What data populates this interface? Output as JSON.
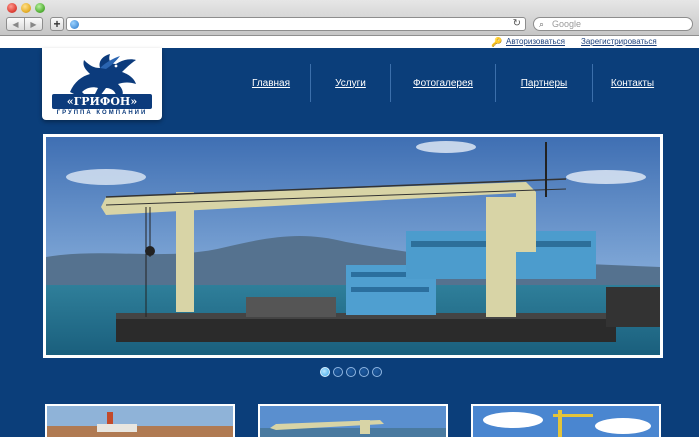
{
  "browser": {
    "search_placeholder": "Google",
    "back_icon": "◀",
    "forward_icon": "▶",
    "add_icon": "+",
    "reload_icon": "↻",
    "search_icon": "⌕"
  },
  "topbar": {
    "login_label": "Авторизоваться",
    "register_label": "Зарегистрироваться"
  },
  "logo": {
    "name": "«ГРИФОН»",
    "tagline": "ГРУППА КОМПАНИЙ"
  },
  "nav": {
    "items": [
      {
        "label": "Главная"
      },
      {
        "label": "Услуги"
      },
      {
        "label": "Фотогалерея"
      },
      {
        "label": "Партнеры"
      },
      {
        "label": "Контакты"
      }
    ]
  },
  "slider": {
    "slide_count": 5,
    "active_index": 0
  },
  "colors": {
    "page_bg": "#0b3e7a",
    "accent": "#3aa6e8"
  }
}
